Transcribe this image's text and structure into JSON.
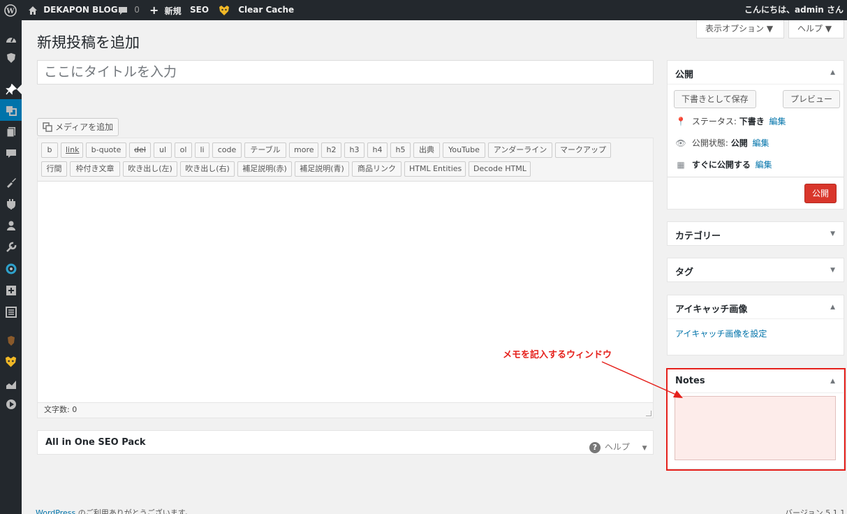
{
  "adminbar": {
    "site_name": "DEKAPON BLOG",
    "comments_count": "0",
    "new_label": "新規",
    "seo_label": "SEO",
    "clear_cache_label": "Clear Cache",
    "greeting": "こんにちは、admin さん"
  },
  "screen_options": {
    "display_options": "表示オプション ▼",
    "help": "ヘルプ ▼"
  },
  "page": {
    "title": "新規投稿を追加",
    "title_placeholder": "ここにタイトルを入力"
  },
  "media_button": "メディアを追加",
  "quicktags_row1": [
    "b",
    "link",
    "b-quote",
    "del",
    "ul",
    "ol",
    "li",
    "code",
    "テーブル",
    "more",
    "h2",
    "h3",
    "h4",
    "h5",
    "出典",
    "YouTube",
    "アンダーライン",
    "マークアップ"
  ],
  "quicktags_row2": [
    "行間",
    "枠付き文章",
    "吹き出し(左)",
    "吹き出し(右)",
    "補足説明(赤)",
    "補足説明(青)",
    "商品リンク",
    "HTML Entities",
    "Decode HTML"
  ],
  "editor": {
    "word_count": "文字数: 0"
  },
  "seo_box": {
    "title": "All in One SEO Pack",
    "help": "ヘルプ"
  },
  "publish_box": {
    "title": "公開",
    "save_draft": "下書きとして保存",
    "preview": "プレビュー",
    "status_label": "ステータス:",
    "status_value": "下書き",
    "visibility_label": "公開状態:",
    "visibility_value": "公開",
    "schedule_label": "すぐに公開する",
    "edit_link": "編集",
    "publish_button": "公開"
  },
  "category_box": {
    "title": "カテゴリー"
  },
  "tag_box": {
    "title": "タグ"
  },
  "featured_box": {
    "title": "アイキャッチ画像",
    "set_link": "アイキャッチ画像を設定"
  },
  "notes_box": {
    "title": "Notes"
  },
  "annotation": {
    "text": "メモを記入するウィンドウ",
    "color": "#e5201b"
  },
  "footer": {
    "left_link": "WordPress",
    "left_text": " のご利用ありがとうございます。",
    "version": "バージョン 5.1.1"
  },
  "colors": {
    "adminbar": "#23282d",
    "accent": "#0073aa",
    "publish": "#d9362b",
    "annotation": "#e5201b"
  }
}
